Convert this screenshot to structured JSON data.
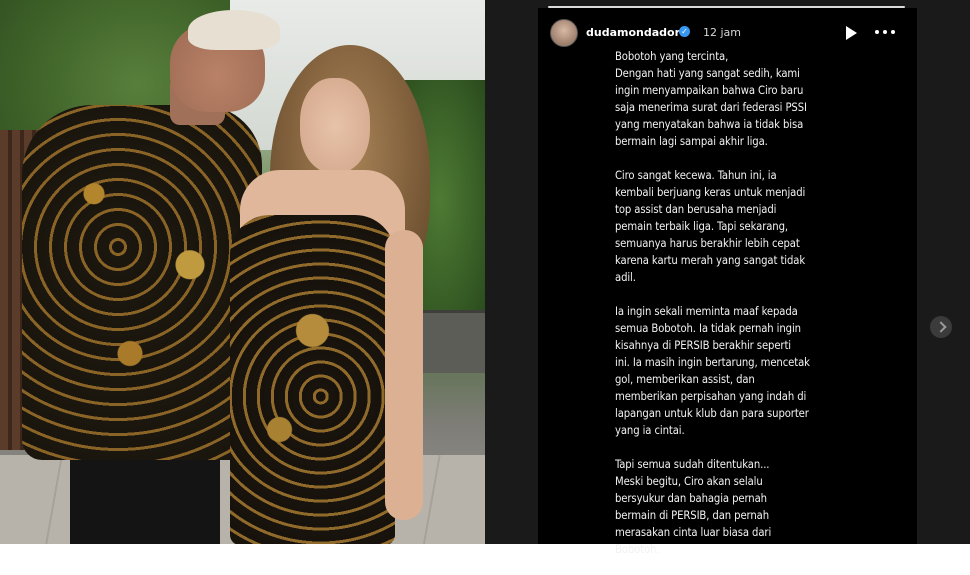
{
  "story": {
    "username": "dudamondadori",
    "time": "12 jam",
    "verified_mark": "✓",
    "icons": {
      "avatar": "profile-avatar",
      "play": "play-icon",
      "more": "more-icon",
      "verified": "verified-badge-icon",
      "next": "chevron-right-icon"
    },
    "paragraphs": [
      "Bobotoh yang tercinta,\nDengan hati yang sangat sedih, kami\ningin menyampaikan bahwa Ciro baru\nsaja menerima surat dari federasi PSSI\nyang menyatakan bahwa ia tidak bisa\nbermain lagi sampai akhir liga.",
      "Ciro sangat kecewa. Tahun ini, ia\nkembali berjuang keras untuk menjadi\ntop assist dan berusaha menjadi\npemain terbaik liga. Tapi sekarang,\nsemuanya harus berakhir lebih cepat\nkarena kartu merah yang sangat tidak\nadil.",
      "Ia ingin sekali meminta maaf kepada\nsemua Bobotoh. Ia tidak pernah ingin\nkisahnya di PERSIB berakhir seperti\nini. Ia masih ingin bertarung, mencetak\ngol, memberikan assist, dan\nmemberikan perpisahan yang indah di\nlapangan untuk klub dan para suporter\nyang ia cintai.",
      "Tapi semua sudah ditentukan...\nMeski begitu, Ciro akan selalu\nbersyukur dan bahagia pernah\nbermain di PERSIB, dan pernah\nmerasakan cinta luar biasa dari\nBobotoh."
    ]
  },
  "colors": {
    "panel_background": "#1a1a1a",
    "story_background": "#000000",
    "text": "#f2f2f2",
    "verified_blue": "#3897f0"
  }
}
